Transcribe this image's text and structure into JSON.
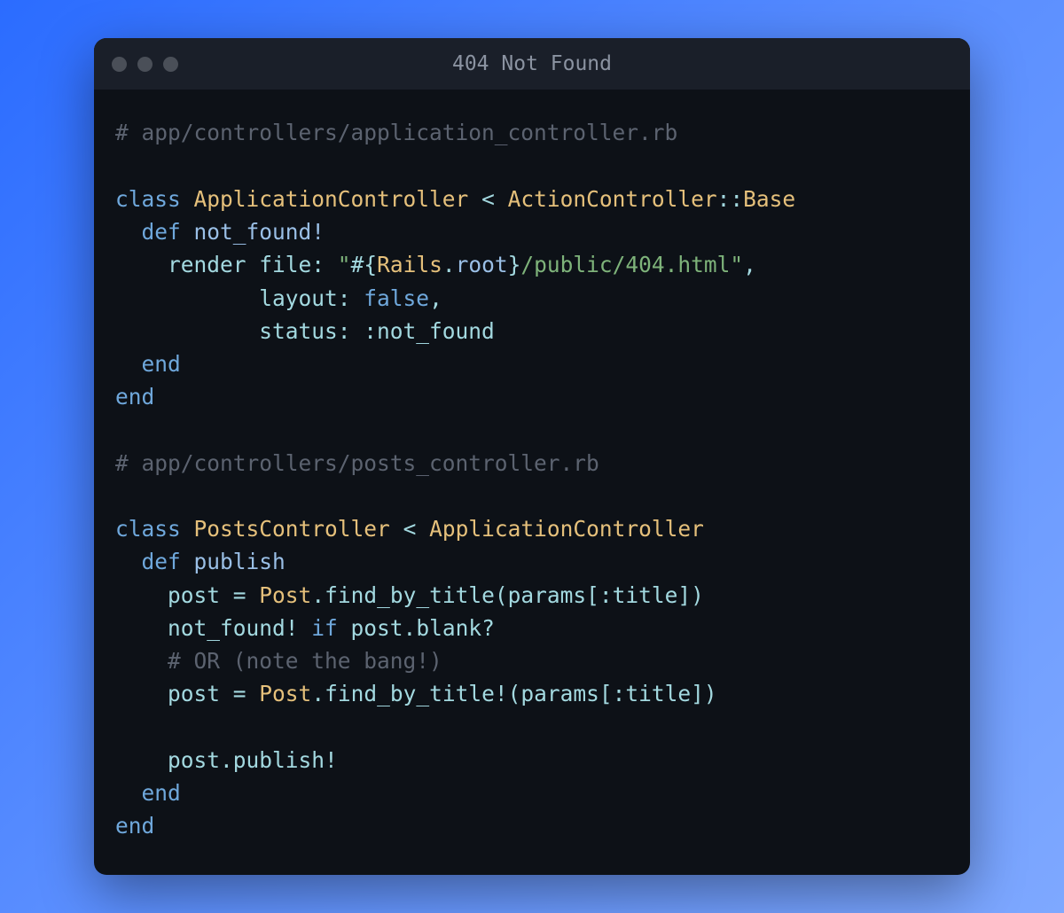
{
  "window": {
    "title": "404 Not Found"
  },
  "code": {
    "lines": [
      {
        "segments": [
          {
            "cls": "c-comment",
            "text": "# app/controllers/application_controller.rb"
          }
        ]
      },
      {
        "segments": [
          {
            "cls": "",
            "text": ""
          }
        ]
      },
      {
        "segments": [
          {
            "cls": "c-keyword",
            "text": "class"
          },
          {
            "cls": "",
            "text": " "
          },
          {
            "cls": "c-classname",
            "text": "ApplicationController"
          },
          {
            "cls": "",
            "text": " "
          },
          {
            "cls": "c-op",
            "text": "<"
          },
          {
            "cls": "",
            "text": " "
          },
          {
            "cls": "c-classname",
            "text": "ActionController"
          },
          {
            "cls": "c-op",
            "text": "::"
          },
          {
            "cls": "c-classname",
            "text": "Base"
          }
        ]
      },
      {
        "segments": [
          {
            "cls": "",
            "text": "  "
          },
          {
            "cls": "c-keyword",
            "text": "def"
          },
          {
            "cls": "",
            "text": " "
          },
          {
            "cls": "c-method",
            "text": "not_found!"
          }
        ]
      },
      {
        "segments": [
          {
            "cls": "",
            "text": "    render "
          },
          {
            "cls": "c-symbol",
            "text": "file:"
          },
          {
            "cls": "",
            "text": " "
          },
          {
            "cls": "c-string",
            "text": "\""
          },
          {
            "cls": "c-interp",
            "text": "#{"
          },
          {
            "cls": "c-classname",
            "text": "Rails"
          },
          {
            "cls": "c-punct",
            "text": "."
          },
          {
            "cls": "c-interpfn",
            "text": "root"
          },
          {
            "cls": "c-interp",
            "text": "}"
          },
          {
            "cls": "c-string",
            "text": "/public/404.html\""
          },
          {
            "cls": "c-punct",
            "text": ","
          }
        ]
      },
      {
        "segments": [
          {
            "cls": "",
            "text": "           "
          },
          {
            "cls": "c-symbol",
            "text": "layout:"
          },
          {
            "cls": "",
            "text": " "
          },
          {
            "cls": "c-keyword",
            "text": "false"
          },
          {
            "cls": "c-punct",
            "text": ","
          }
        ]
      },
      {
        "segments": [
          {
            "cls": "",
            "text": "           "
          },
          {
            "cls": "c-symbol",
            "text": "status:"
          },
          {
            "cls": "",
            "text": " "
          },
          {
            "cls": "c-symbol",
            "text": ":not_found"
          }
        ]
      },
      {
        "segments": [
          {
            "cls": "",
            "text": "  "
          },
          {
            "cls": "c-keyword",
            "text": "end"
          }
        ]
      },
      {
        "segments": [
          {
            "cls": "c-keyword",
            "text": "end"
          }
        ]
      },
      {
        "segments": [
          {
            "cls": "",
            "text": ""
          }
        ]
      },
      {
        "segments": [
          {
            "cls": "c-comment",
            "text": "# app/controllers/posts_controller.rb"
          }
        ]
      },
      {
        "segments": [
          {
            "cls": "",
            "text": ""
          }
        ]
      },
      {
        "segments": [
          {
            "cls": "c-keyword",
            "text": "class"
          },
          {
            "cls": "",
            "text": " "
          },
          {
            "cls": "c-classname",
            "text": "PostsController"
          },
          {
            "cls": "",
            "text": " "
          },
          {
            "cls": "c-op",
            "text": "<"
          },
          {
            "cls": "",
            "text": " "
          },
          {
            "cls": "c-classname",
            "text": "ApplicationController"
          }
        ]
      },
      {
        "segments": [
          {
            "cls": "",
            "text": "  "
          },
          {
            "cls": "c-keyword",
            "text": "def"
          },
          {
            "cls": "",
            "text": " "
          },
          {
            "cls": "c-method",
            "text": "publish"
          }
        ]
      },
      {
        "segments": [
          {
            "cls": "",
            "text": "    post "
          },
          {
            "cls": "c-op",
            "text": "="
          },
          {
            "cls": "",
            "text": " "
          },
          {
            "cls": "c-classname",
            "text": "Post"
          },
          {
            "cls": "c-punct",
            "text": "."
          },
          {
            "cls": "",
            "text": "find_by_title"
          },
          {
            "cls": "c-punct",
            "text": "("
          },
          {
            "cls": "",
            "text": "params"
          },
          {
            "cls": "c-punct",
            "text": "["
          },
          {
            "cls": "c-symbol",
            "text": ":title"
          },
          {
            "cls": "c-punct",
            "text": "])"
          }
        ]
      },
      {
        "segments": [
          {
            "cls": "",
            "text": "    not_found! "
          },
          {
            "cls": "c-keyword",
            "text": "if"
          },
          {
            "cls": "",
            "text": " post"
          },
          {
            "cls": "c-punct",
            "text": "."
          },
          {
            "cls": "",
            "text": "blank?"
          }
        ]
      },
      {
        "segments": [
          {
            "cls": "",
            "text": "    "
          },
          {
            "cls": "c-comment",
            "text": "# OR (note the bang!)"
          }
        ]
      },
      {
        "segments": [
          {
            "cls": "",
            "text": "    post "
          },
          {
            "cls": "c-op",
            "text": "="
          },
          {
            "cls": "",
            "text": " "
          },
          {
            "cls": "c-classname",
            "text": "Post"
          },
          {
            "cls": "c-punct",
            "text": "."
          },
          {
            "cls": "",
            "text": "find_by_title!"
          },
          {
            "cls": "c-punct",
            "text": "("
          },
          {
            "cls": "",
            "text": "params"
          },
          {
            "cls": "c-punct",
            "text": "["
          },
          {
            "cls": "c-symbol",
            "text": ":title"
          },
          {
            "cls": "c-punct",
            "text": "])"
          }
        ]
      },
      {
        "segments": [
          {
            "cls": "",
            "text": ""
          }
        ]
      },
      {
        "segments": [
          {
            "cls": "",
            "text": "    post"
          },
          {
            "cls": "c-punct",
            "text": "."
          },
          {
            "cls": "",
            "text": "publish!"
          }
        ]
      },
      {
        "segments": [
          {
            "cls": "",
            "text": "  "
          },
          {
            "cls": "c-keyword",
            "text": "end"
          }
        ]
      },
      {
        "segments": [
          {
            "cls": "c-keyword",
            "text": "end"
          }
        ]
      }
    ]
  }
}
